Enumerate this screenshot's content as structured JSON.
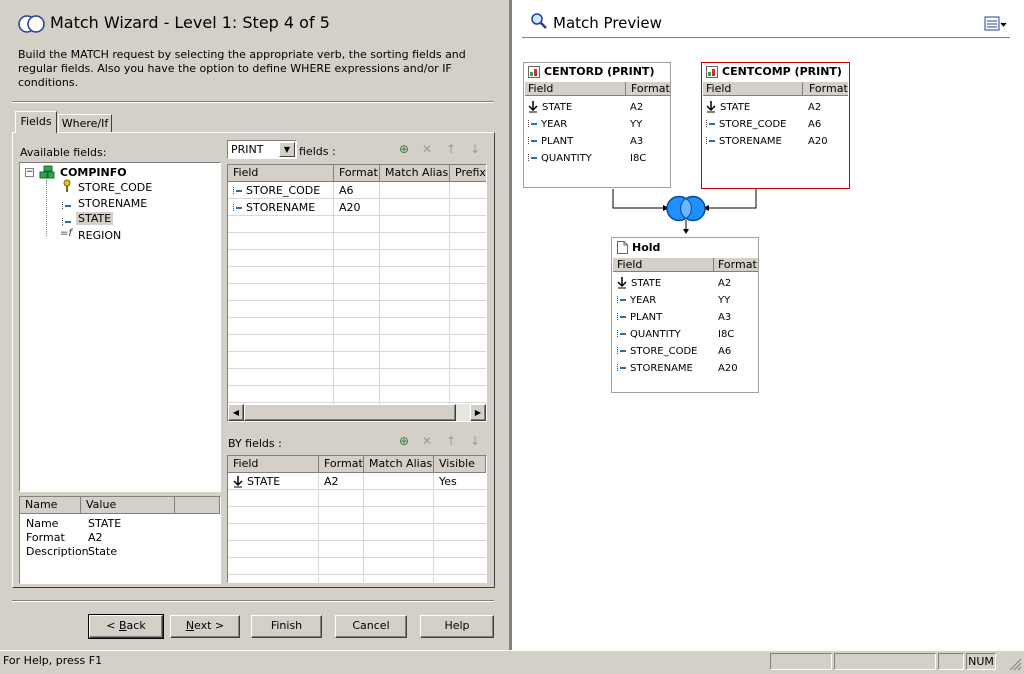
{
  "wizard": {
    "title": "Match Wizard - Level 1: Step 4 of 5",
    "description": "Build the MATCH request by selecting the appropriate verb, the sorting fields and regular fields. Also you have the option to  define WHERE expressions and/or  IF conditions.",
    "tabs": [
      "Fields",
      "Where/If"
    ],
    "available_fields_label": "Available fields:",
    "tree": {
      "root": "COMPINFO",
      "children": [
        "STORE_CODE",
        "STORENAME",
        "STATE",
        "REGION"
      ]
    },
    "properties": {
      "headers": [
        "Name",
        "Value"
      ],
      "rows": [
        {
          "name": "Name",
          "value": "STATE"
        },
        {
          "name": "Format",
          "value": "A2"
        },
        {
          "name": "Description",
          "value": "State"
        }
      ]
    },
    "verb": {
      "selected": "PRINT",
      "suffix": "fields :"
    },
    "print_grid": {
      "headers": [
        "Field",
        "Format",
        "Match Alias",
        "Prefix"
      ],
      "rows": [
        {
          "field": "STORE_CODE",
          "format": "A6"
        },
        {
          "field": "STORENAME",
          "format": "A20"
        }
      ]
    },
    "by_label": "BY fields :",
    "by_grid": {
      "headers": [
        "Field",
        "Format",
        "Match Alias",
        "Visible"
      ],
      "rows": [
        {
          "field": "STATE",
          "format": "A2",
          "alias": "",
          "visible": "Yes"
        }
      ]
    },
    "buttons": {
      "back": "Back",
      "next": "Next >",
      "finish": "Finish",
      "cancel": "Cancel",
      "help": "Help"
    }
  },
  "preview": {
    "title": "Match Preview",
    "field_header": "Field",
    "format_header": "Format",
    "centord": {
      "title": "CENTORD (PRINT)",
      "rows": [
        {
          "field": "STATE",
          "format": "A2",
          "sort": true
        },
        {
          "field": "YEAR",
          "format": "YY"
        },
        {
          "field": "PLANT",
          "format": "A3"
        },
        {
          "field": "QUANTITY",
          "format": "I8C"
        }
      ]
    },
    "centcomp": {
      "title": "CENTCOMP (PRINT)",
      "rows": [
        {
          "field": "STATE",
          "format": "A2",
          "sort": true
        },
        {
          "field": "STORE_CODE",
          "format": "A6"
        },
        {
          "field": "STORENAME",
          "format": "A20"
        }
      ]
    },
    "hold": {
      "title": "Hold",
      "rows": [
        {
          "field": "STATE",
          "format": "A2",
          "sort": true
        },
        {
          "field": "YEAR",
          "format": "YY"
        },
        {
          "field": "PLANT",
          "format": "A3"
        },
        {
          "field": "QUANTITY",
          "format": "I8C"
        },
        {
          "field": "STORE_CODE",
          "format": "A6"
        },
        {
          "field": "STORENAME",
          "format": "A20"
        }
      ]
    }
  },
  "status": {
    "help_text": "For Help, press F1",
    "num": "NUM"
  },
  "colors": {
    "accent_blue": "#1e90ff",
    "selection_red": "#d00000",
    "panel": "#d4d0c8"
  }
}
